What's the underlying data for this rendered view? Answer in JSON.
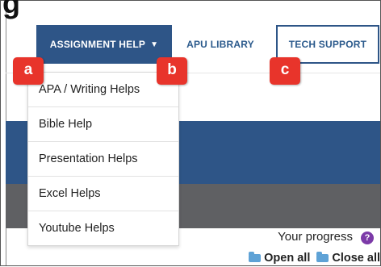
{
  "heading_fragment": "g",
  "nav": {
    "assignment_help": "ASSIGNMENT HELP",
    "library": "APU LIBRARY",
    "tech_support": "TECH SUPPORT"
  },
  "dropdown_items": [
    "APA / Writing Helps",
    "Bible Help",
    "Presentation Helps",
    "Excel Helps",
    "Youtube Helps"
  ],
  "callouts": [
    "a",
    "b",
    "c"
  ],
  "progress": {
    "label": "Your progress",
    "icon": "question-icon"
  },
  "controls": {
    "open_all": "Open all",
    "close_all": "Close all"
  },
  "colors": {
    "primary_blue": "#2e5587",
    "band_gray": "#5f6063",
    "callout_red": "#e8342b",
    "help_purple": "#7c3aa8",
    "folder_blue": "#5ea2d6"
  }
}
